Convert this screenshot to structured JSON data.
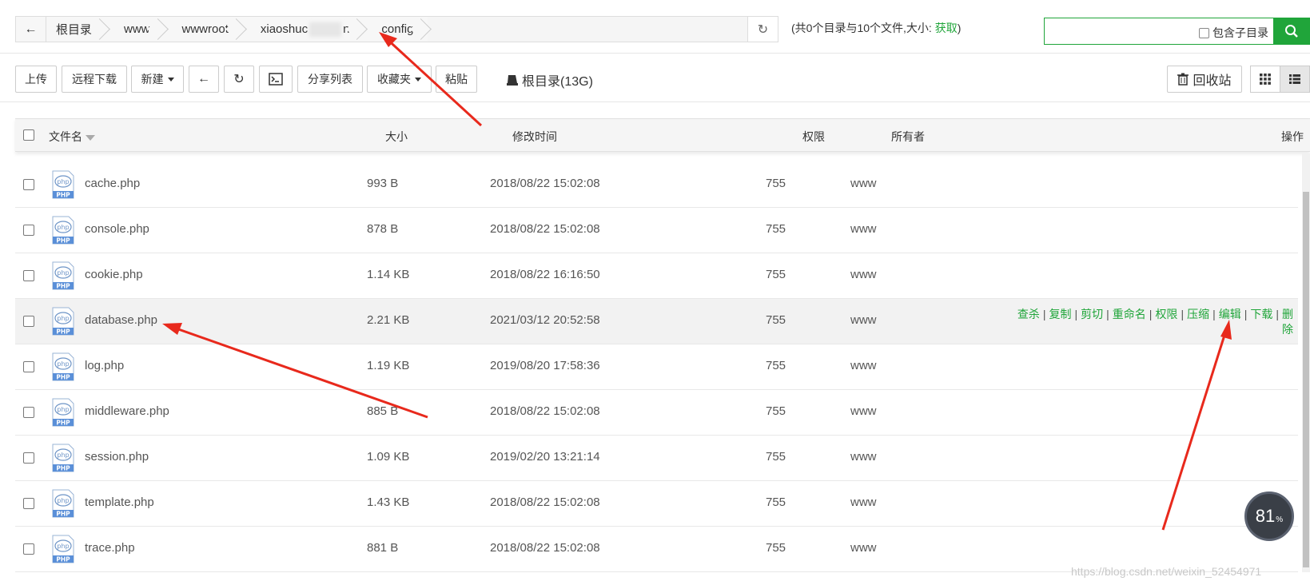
{
  "pathbar": {
    "crumbs": [
      "根目录",
      "www",
      "wwwroot",
      "xiaoshuc",
      "n",
      "config"
    ]
  },
  "dirinfo": {
    "prefix": "(共0个目录与10个文件,大小: ",
    "fetch": "获取",
    "suffix": ")"
  },
  "search": {
    "value": "",
    "subdir_label": "包含子目录"
  },
  "toolbar": {
    "upload": "上传",
    "remote_download": "远程下载",
    "new": "新建",
    "share_list": "分享列表",
    "favorites": "收藏夹",
    "paste": "粘贴",
    "disk": "根目录(13G)",
    "recycle": "回收站"
  },
  "table": {
    "headers": {
      "name": "文件名",
      "size": "大小",
      "mtime": "修改时间",
      "perm": "权限",
      "owner": "所有者",
      "ops": "操作"
    },
    "rows": [
      {
        "name": "cache.php",
        "size": "993 B",
        "mtime": "2018/08/22 15:02:08",
        "perm": "755",
        "owner": "www"
      },
      {
        "name": "console.php",
        "size": "878 B",
        "mtime": "2018/08/22 15:02:08",
        "perm": "755",
        "owner": "www"
      },
      {
        "name": "cookie.php",
        "size": "1.14 KB",
        "mtime": "2018/08/22 16:16:50",
        "perm": "755",
        "owner": "www"
      },
      {
        "name": "database.php",
        "size": "2.21 KB",
        "mtime": "2021/03/12 20:52:58",
        "perm": "755",
        "owner": "www"
      },
      {
        "name": "log.php",
        "size": "1.19 KB",
        "mtime": "2019/08/20 17:58:36",
        "perm": "755",
        "owner": "www"
      },
      {
        "name": "middleware.php",
        "size": "885 B",
        "mtime": "2018/08/22 15:02:08",
        "perm": "755",
        "owner": "www"
      },
      {
        "name": "session.php",
        "size": "1.09 KB",
        "mtime": "2019/02/20 13:21:14",
        "perm": "755",
        "owner": "www"
      },
      {
        "name": "template.php",
        "size": "1.43 KB",
        "mtime": "2018/08/22 15:02:08",
        "perm": "755",
        "owner": "www"
      },
      {
        "name": "trace.php",
        "size": "881 B",
        "mtime": "2018/08/22 15:02:08",
        "perm": "755",
        "owner": "www"
      }
    ],
    "row_ops": [
      "查杀",
      "复制",
      "剪切",
      "重命名",
      "权限",
      "压缩",
      "编辑",
      "下载",
      "删",
      "除"
    ],
    "file_icon_label": "PHP",
    "file_icon_badge": "php"
  },
  "widget": {
    "percent": "81",
    "unit": "%"
  },
  "watermark": "https://blog.csdn.net/weixin_52454971",
  "colors": {
    "accent": "#20a53a",
    "arrow": "#e8291c"
  }
}
